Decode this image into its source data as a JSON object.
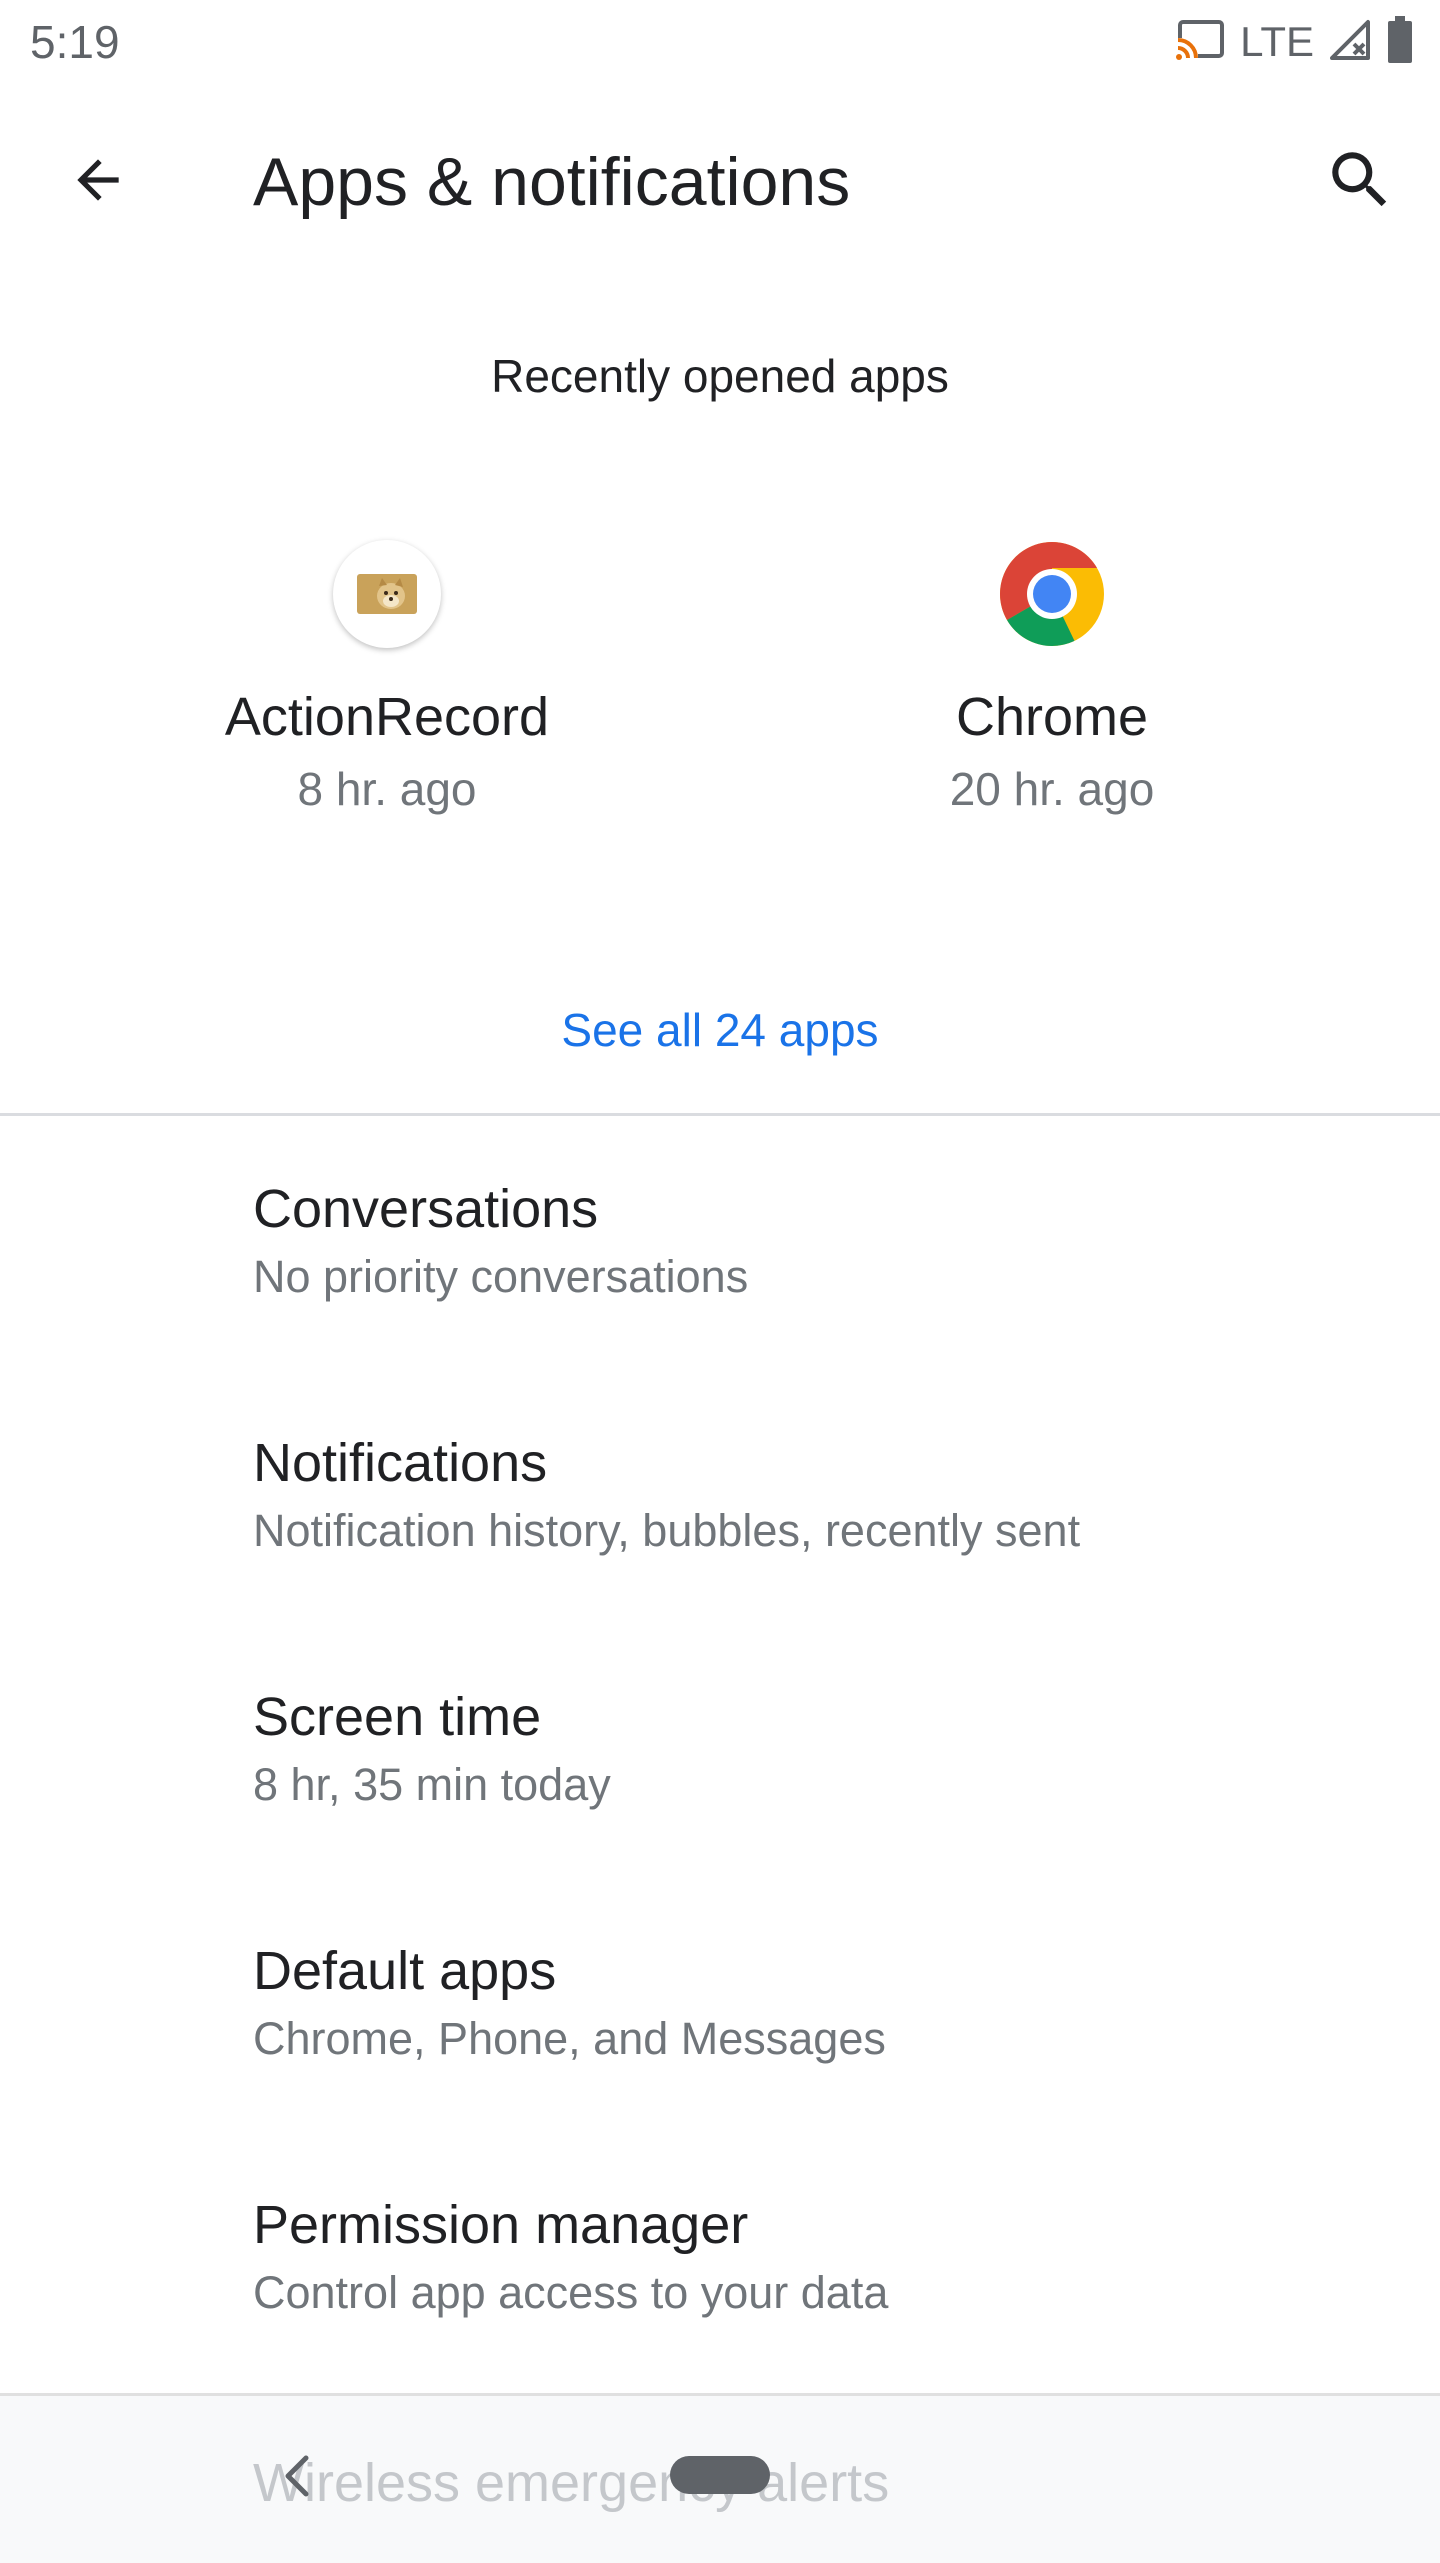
{
  "status_bar": {
    "time": "5:19",
    "network": "LTE",
    "icons": [
      "cast-icon",
      "signal-icon",
      "battery-icon"
    ]
  },
  "app_bar": {
    "title": "Apps & notifications",
    "back_icon": "arrow-back-icon",
    "search_icon": "search-icon"
  },
  "recent": {
    "header": "Recently opened apps",
    "apps": [
      {
        "name": "ActionRecord",
        "time": "8 hr. ago",
        "icon": "actionrecord-icon"
      },
      {
        "name": "Chrome",
        "time": "20 hr. ago",
        "icon": "chrome-icon"
      }
    ],
    "see_all": "See all 24 apps"
  },
  "settings": [
    {
      "title": "Conversations",
      "subtitle": "No priority conversations"
    },
    {
      "title": "Notifications",
      "subtitle": "Notification history, bubbles, recently sent"
    },
    {
      "title": "Screen time",
      "subtitle": "8 hr, 35 min today"
    },
    {
      "title": "Default apps",
      "subtitle": "Chrome, Phone, and Messages"
    },
    {
      "title": "Permission manager",
      "subtitle": "Control app access to your data"
    }
  ],
  "partially_visible_item": "Wireless emergency alerts",
  "colors": {
    "accent": "#1a73e8",
    "text_primary": "#202124",
    "text_secondary": "#70757a",
    "divider": "#dadce0"
  }
}
